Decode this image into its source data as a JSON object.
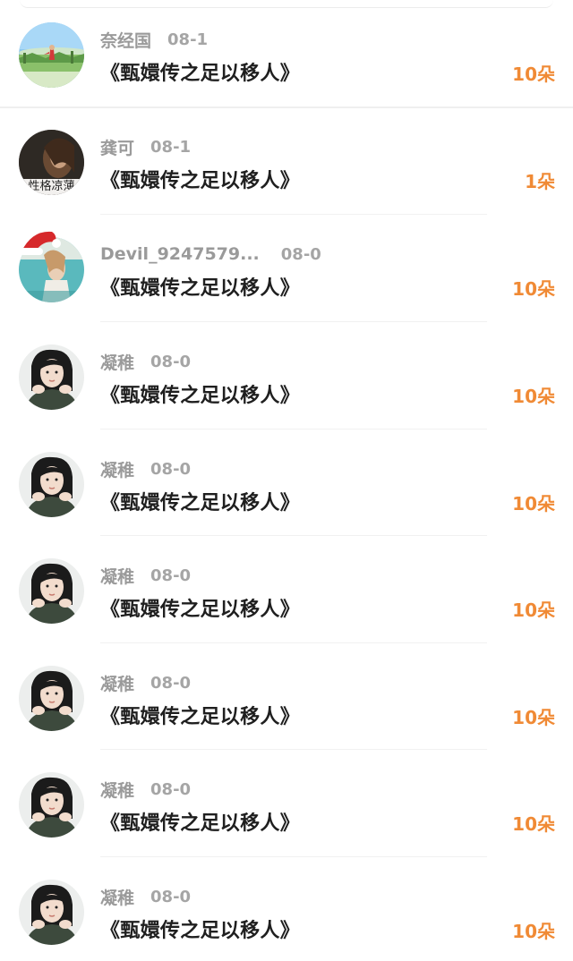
{
  "feed": {
    "items": [
      {
        "username": "奈经国",
        "date": "08-1",
        "title": "《甄嬛传之足以移人》",
        "count": "10朵",
        "avatar": "landscape-avatar"
      },
      {
        "username": "龚可",
        "date": "08-1",
        "title": "《甄嬛传之足以移人》",
        "count": "1朵",
        "avatar": "dark-portrait-avatar",
        "avatar_text": "性格凉薄"
      },
      {
        "username": "Devil_9247579...",
        "date": "08-0",
        "title": "《甄嬛传之足以移人》",
        "count": "10朵",
        "avatar": "santa-hat-avatar"
      },
      {
        "username": "凝稚",
        "date": "08-0",
        "title": "《甄嬛传之足以移人》",
        "count": "10朵",
        "avatar": "girl-portrait-avatar"
      },
      {
        "username": "凝稚",
        "date": "08-0",
        "title": "《甄嬛传之足以移人》",
        "count": "10朵",
        "avatar": "girl-portrait-avatar"
      },
      {
        "username": "凝稚",
        "date": "08-0",
        "title": "《甄嬛传之足以移人》",
        "count": "10朵",
        "avatar": "girl-portrait-avatar"
      },
      {
        "username": "凝稚",
        "date": "08-0",
        "title": "《甄嬛传之足以移人》",
        "count": "10朵",
        "avatar": "girl-portrait-avatar"
      },
      {
        "username": "凝稚",
        "date": "08-0",
        "title": "《甄嬛传之足以移人》",
        "count": "10朵",
        "avatar": "girl-portrait-avatar"
      },
      {
        "username": "凝稚",
        "date": "08-0",
        "title": "《甄嬛传之足以移人》",
        "count": "10朵",
        "avatar": "girl-portrait-avatar"
      }
    ]
  },
  "colors": {
    "count": "#f08a35",
    "title": "#1f1f1f",
    "username": "#9a9a9a",
    "date": "#a5a5a5",
    "divider": "#efefef"
  }
}
